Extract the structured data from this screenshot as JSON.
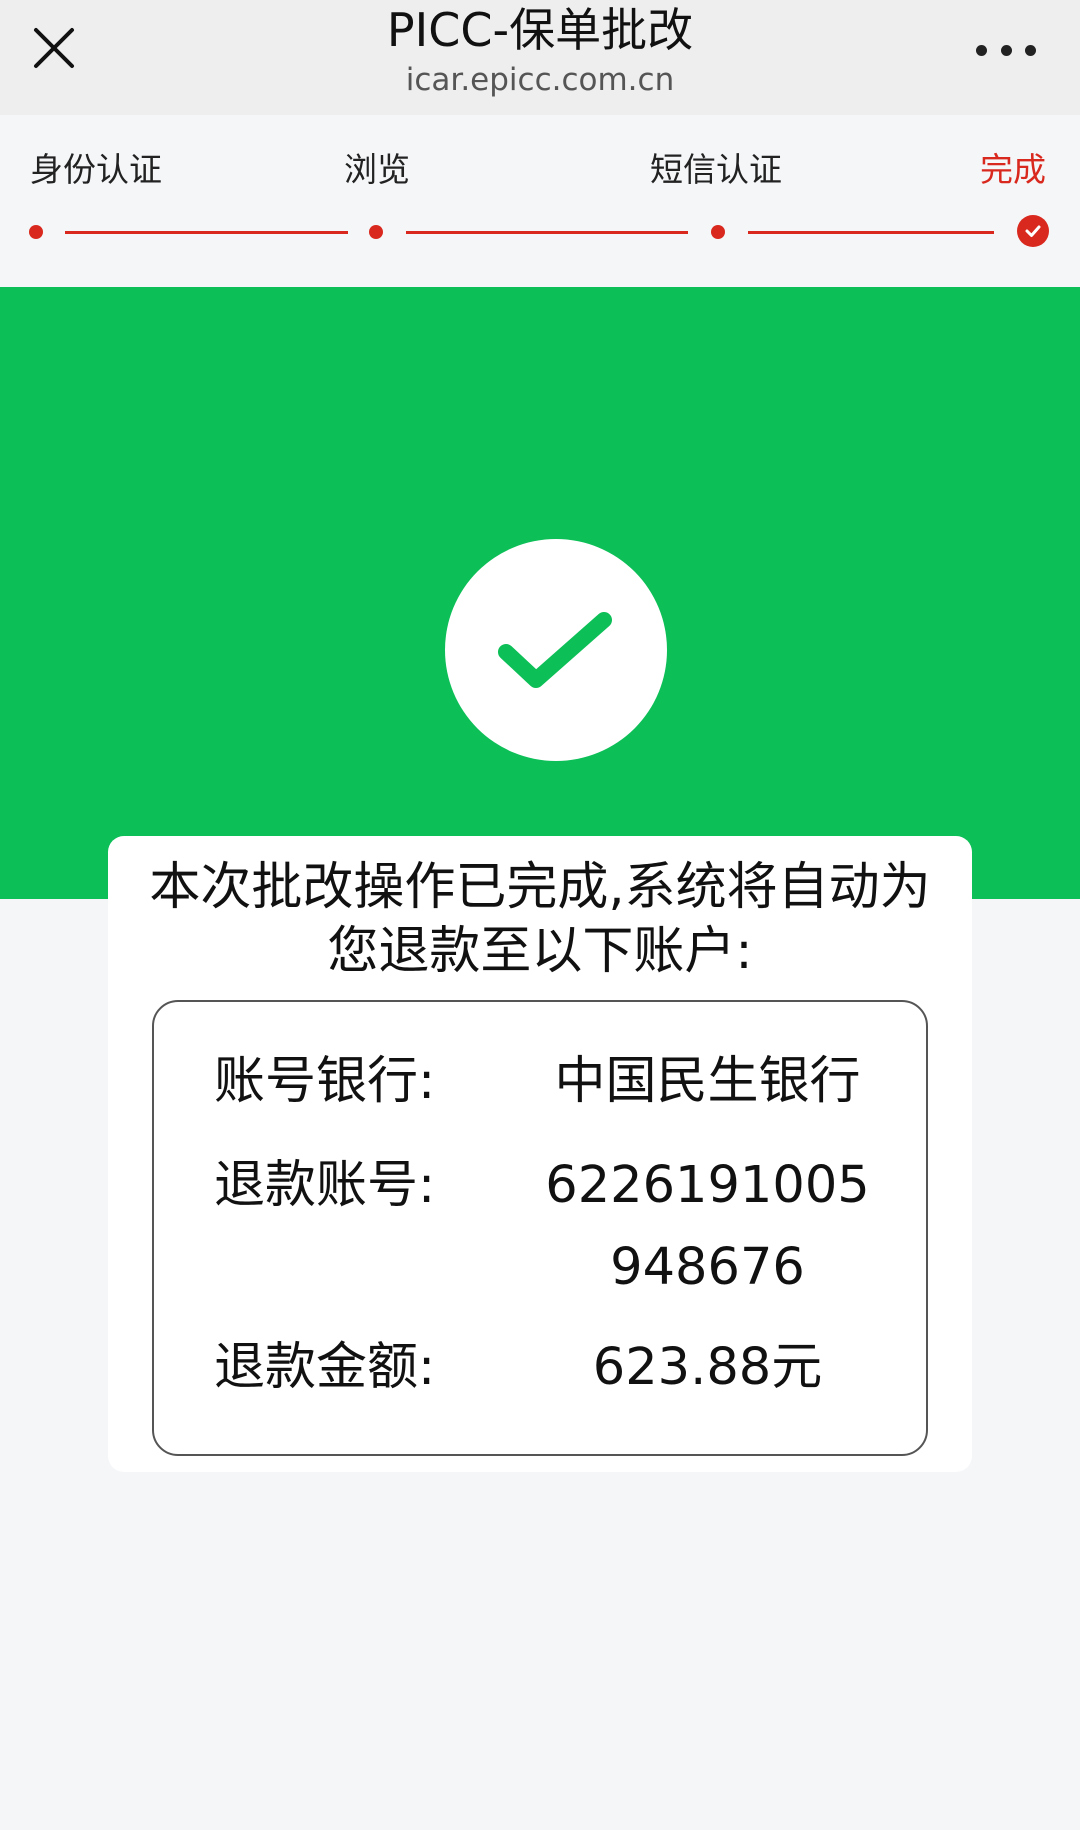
{
  "header": {
    "title": "PICC-保单批改",
    "url": "icar.epicc.com.cn"
  },
  "steps": [
    {
      "label": "身份认证",
      "state": "done"
    },
    {
      "label": "浏览",
      "state": "done"
    },
    {
      "label": "短信认证",
      "state": "done"
    },
    {
      "label": "完成",
      "state": "current"
    }
  ],
  "result": {
    "message": "本次批改操作已完成,系统将自动为您退款至以下账户:",
    "rows": [
      {
        "label": "账号银行:",
        "value": "中国民生银行"
      },
      {
        "label": "退款账号:",
        "value": "6226191005948676"
      },
      {
        "label": "退款金额:",
        "value": "623.88元"
      }
    ]
  },
  "colors": {
    "accent_red": "#d9281e",
    "success_green": "#0cbf57"
  },
  "icons": {
    "close": "close-icon",
    "more": "more-dots-icon",
    "step_done": "check-circle-icon",
    "success": "checkmark-icon"
  }
}
